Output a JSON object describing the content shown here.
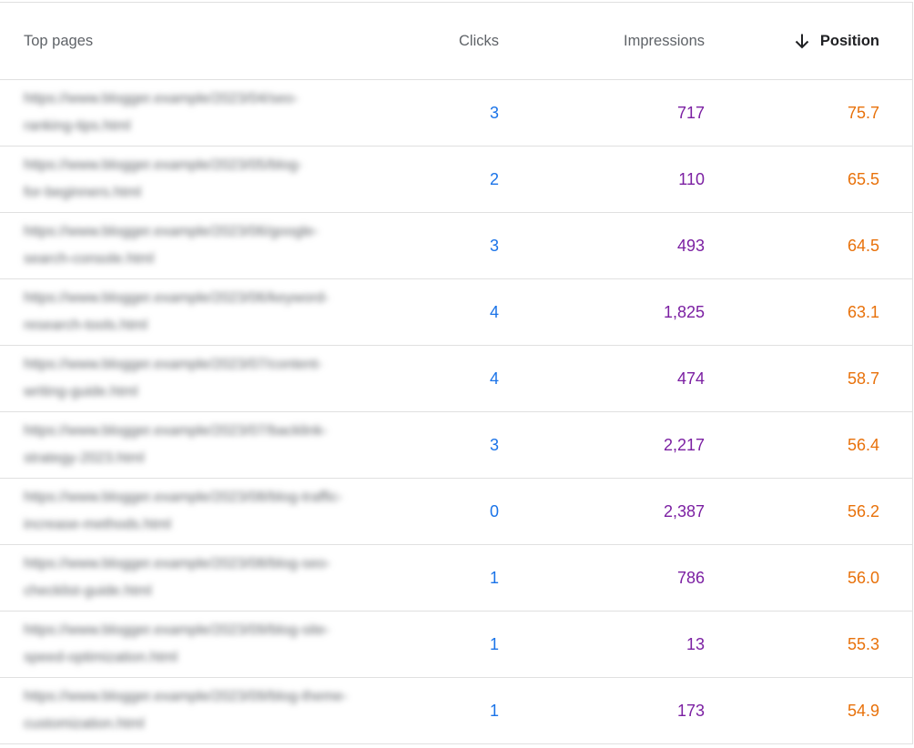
{
  "header": {
    "page_label": "Top pages",
    "clicks_label": "Clicks",
    "impressions_label": "Impressions",
    "position_label": "Position",
    "sort_icon": "arrow-down-icon"
  },
  "rows": [
    {
      "url_line1": "https://www.blogger.example/2023/04/seo-",
      "url_line2": "ranking-tips.html",
      "clicks": "3",
      "impressions": "717",
      "position": "75.7"
    },
    {
      "url_line1": "https://www.blogger.example/2023/05/blog-",
      "url_line2": "for-beginners.html",
      "clicks": "2",
      "impressions": "110",
      "position": "65.5"
    },
    {
      "url_line1": "https://www.blogger.example/2023/06/google-",
      "url_line2": "search-console.html",
      "clicks": "3",
      "impressions": "493",
      "position": "64.5"
    },
    {
      "url_line1": "https://www.blogger.example/2023/06/keyword-",
      "url_line2": "research-tools.html",
      "clicks": "4",
      "impressions": "1,825",
      "position": "63.1"
    },
    {
      "url_line1": "https://www.blogger.example/2023/07/content-",
      "url_line2": "writing-guide.html",
      "clicks": "4",
      "impressions": "474",
      "position": "58.7"
    },
    {
      "url_line1": "https://www.blogger.example/2023/07/backlink-",
      "url_line2": "strategy-2023.html",
      "clicks": "3",
      "impressions": "2,217",
      "position": "56.4"
    },
    {
      "url_line1": "https://www.blogger.example/2023/08/blog-traffic-",
      "url_line2": "increase-methods.html",
      "clicks": "0",
      "impressions": "2,387",
      "position": "56.2"
    },
    {
      "url_line1": "https://www.blogger.example/2023/08/blog-seo-",
      "url_line2": "checklist-guide.html",
      "clicks": "1",
      "impressions": "786",
      "position": "56.0"
    },
    {
      "url_line1": "https://www.blogger.example/2023/09/blog-site-",
      "url_line2": "speed-optimization.html",
      "clicks": "1",
      "impressions": "13",
      "position": "55.3"
    },
    {
      "url_line1": "https://www.blogger.example/2023/09/blog-theme-",
      "url_line2": "customization.html",
      "clicks": "1",
      "impressions": "173",
      "position": "54.9"
    }
  ]
}
